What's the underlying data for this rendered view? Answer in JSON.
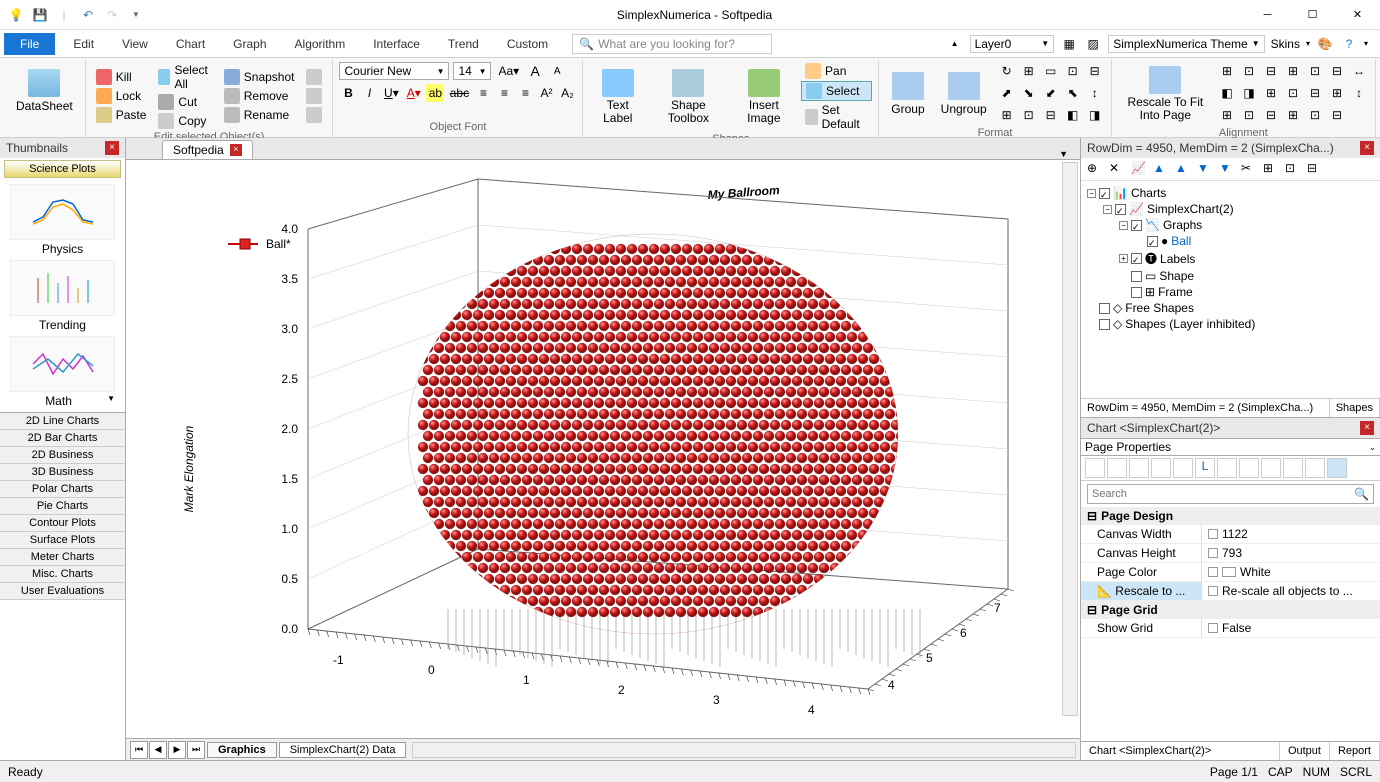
{
  "app_title": "SimplexNumerica - Softpedia",
  "quick_access": [
    "bulb",
    "save",
    "undo",
    "redo",
    "dropdown"
  ],
  "menu": {
    "file": "File",
    "items": [
      "Edit",
      "View",
      "Chart",
      "Graph",
      "Algorithm",
      "Interface",
      "Trend",
      "Custom"
    ],
    "search_placeholder": "What are you looking for?",
    "layer": "Layer0",
    "theme": "SimplexNumerica Theme",
    "skins": "Skins"
  },
  "ribbon": {
    "datasheet": "DataSheet",
    "kill": "Kill",
    "lock": "Lock",
    "paste": "Paste",
    "selectall": "Select All",
    "cut": "Cut",
    "copy": "Copy",
    "snapshot": "Snapshot",
    "remove": "Remove",
    "rename": "Rename",
    "group1_label": "Edit selected Object(s)",
    "font_name": "Courier New",
    "font_size": "14",
    "group2_label": "Object Font",
    "text_label": "Text Label",
    "shape_toolbox": "Shape Toolbox",
    "insert_image": "Insert Image",
    "pan": "Pan",
    "select": "Select",
    "set_default": "Set Default",
    "group3_label": "Shapes",
    "group": "Group",
    "ungroup": "Ungroup",
    "group4_label": "Format",
    "rescale": "Rescale To Fit Into Page",
    "group5_label": "Alignment"
  },
  "left": {
    "header": "Thumbnails",
    "active_cat": "Science Plots",
    "thumbs": [
      "Physics",
      "Trending",
      "Math"
    ],
    "cats": [
      "2D Line Charts",
      "2D Bar Charts",
      "2D Business",
      "3D Business",
      "Polar Charts",
      "Pie Charts",
      "Contour Plots",
      "Surface Plots",
      "Meter Charts",
      "Misc. Charts",
      "User Evaluations"
    ]
  },
  "doc": {
    "tab": "Softpedia"
  },
  "chart": {
    "title": "My Ballroom",
    "legend": "Ball*",
    "ylabel": "Mark Elongation",
    "yticks": [
      "0.0",
      "0.5",
      "1.0",
      "1.5",
      "2.0",
      "2.5",
      "3.0",
      "3.5",
      "4.0"
    ],
    "xticks": [
      "-1",
      "0",
      "1",
      "2",
      "3",
      "4"
    ],
    "zticks": [
      "4",
      "5",
      "6",
      "7"
    ]
  },
  "bottom_tabs": {
    "graphics": "Graphics",
    "data": "SimplexChart(2) Data"
  },
  "right": {
    "header": "RowDim = 4950, MemDim = 2 (SimplexCha...)",
    "tree": {
      "charts": "Charts",
      "simplexchart": "SimplexChart(2)",
      "graphs": "Graphs",
      "ball": "Ball",
      "labels": "Labels",
      "shape": "Shape",
      "frame": "Frame",
      "freeshapes": "Free Shapes",
      "shapeslayer": "Shapes (Layer inhibited)"
    },
    "statrow1": "RowDim = 4950, MemDim = 2 (SimplexCha...)",
    "statrow2": "Shapes",
    "prop_header": "Chart <SimplexChart(2)>",
    "page_properties": "Page Properties",
    "search_placeholder": "Search",
    "grp_design": "Page Design",
    "canvas_w_k": "Canvas Width",
    "canvas_w_v": "1122",
    "canvas_h_k": "Canvas Height",
    "canvas_h_v": "793",
    "page_color_k": "Page Color",
    "page_color_v": "White",
    "rescale_k": "Rescale to ...",
    "rescale_v": "Re-scale all objects to ...",
    "grp_grid": "Page Grid",
    "show_grid_k": "Show Grid",
    "show_grid_v": "False",
    "btabs": {
      "chart": "Chart <SimplexChart(2)>",
      "output": "Output",
      "report": "Report"
    }
  },
  "statusbar": {
    "ready": "Ready",
    "page": "Page 1/1",
    "cap": "CAP",
    "num": "NUM",
    "scrl": "SCRL"
  }
}
